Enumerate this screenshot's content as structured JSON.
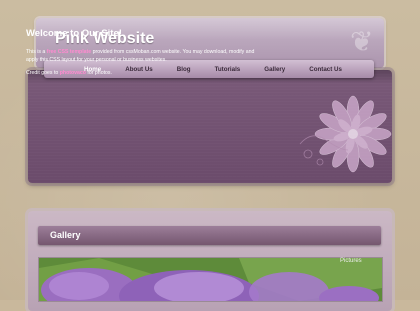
{
  "site": {
    "title": "Pink Website"
  },
  "nav": {
    "items": [
      {
        "label": "Home",
        "active": true
      },
      {
        "label": "About Us",
        "active": false
      },
      {
        "label": "Blog",
        "active": false
      },
      {
        "label": "Tutorials",
        "active": false
      },
      {
        "label": "Gallery",
        "active": false
      },
      {
        "label": "Contact Us",
        "active": false
      }
    ]
  },
  "welcome": {
    "title": "Welcome to Our Site!",
    "p1_a": "This is a ",
    "p1_link": "free CSS template",
    "p1_b": " provided from cssMoban.com website. You may download, modify and apply this CSS layout for your personal or business websites.",
    "credit_a": "Credit goes to ",
    "credit_link": "photovaco",
    "credit_b": " for photos."
  },
  "gallery": {
    "title": "Gallery",
    "image_label": "Pictures"
  },
  "colors": {
    "accent": "#ff8ad0",
    "panel": "#6b4b6b",
    "background": "#c9b89c"
  }
}
